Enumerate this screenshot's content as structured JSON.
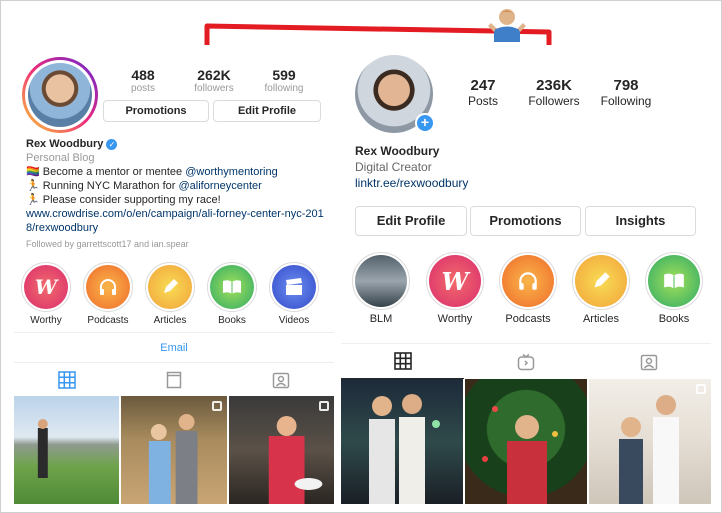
{
  "before": {
    "stats": [
      {
        "value": "488",
        "label": "posts"
      },
      {
        "value": "262K",
        "label": "followers"
      },
      {
        "value": "599",
        "label": "following"
      }
    ],
    "buttons": {
      "promotions": "Promotions",
      "edit_profile": "Edit Profile"
    },
    "bio": {
      "name": "Rex Woodbury",
      "category": "Personal Blog",
      "line1_prefix": "🏳️‍🌈 Become a mentor or mentee ",
      "line1_mention": "@worthymentoring",
      "line2_prefix": "🏃 Running NYC Marathon for ",
      "line2_mention": "@aliforneycenter",
      "line3": "🏃 Please consider supporting my race!",
      "link": "www.crowdrise.com/o/en/campaign/ali-forney-center-nyc-2018/rexwoodbury",
      "followed_by": "Followed by garrettscott17 and ian.spear"
    },
    "highlights": [
      {
        "label": "Worthy",
        "icon": "worthy-w-icon",
        "color": "#ef4a5a"
      },
      {
        "label": "Podcasts",
        "icon": "headphones-icon",
        "color": "#f59a3a"
      },
      {
        "label": "Articles",
        "icon": "pencil-icon",
        "color": "#f3c33a"
      },
      {
        "label": "Books",
        "icon": "book-icon",
        "color": "#57c45a"
      },
      {
        "label": "Videos",
        "icon": "clapperboard-icon",
        "color": "#3a68d8"
      }
    ],
    "email_label": "Email"
  },
  "after": {
    "stats": [
      {
        "value": "247",
        "label": "Posts"
      },
      {
        "value": "236K",
        "label": "Followers"
      },
      {
        "value": "798",
        "label": "Following"
      }
    ],
    "bio": {
      "name": "Rex Woodbury",
      "category": "Digital Creator",
      "link": "linktr.ee/rexwoodbury"
    },
    "buttons": {
      "edit_profile": "Edit Profile",
      "promotions": "Promotions",
      "insights": "Insights"
    },
    "highlights": [
      {
        "label": "BLM",
        "icon": "blm-photo-icon",
        "color": "#6d7b86"
      },
      {
        "label": "Worthy",
        "icon": "worthy-w-icon",
        "color": "#ef4a5a"
      },
      {
        "label": "Podcasts",
        "icon": "headphones-icon",
        "color": "#f59a3a"
      },
      {
        "label": "Articles",
        "icon": "pencil-icon",
        "color": "#f3c33a"
      },
      {
        "label": "Books",
        "icon": "book-icon",
        "color": "#57c45a"
      }
    ]
  },
  "annotation": {
    "arrow_color": "#e31b23",
    "emoji_icon": "shrug-emoji-icon"
  }
}
